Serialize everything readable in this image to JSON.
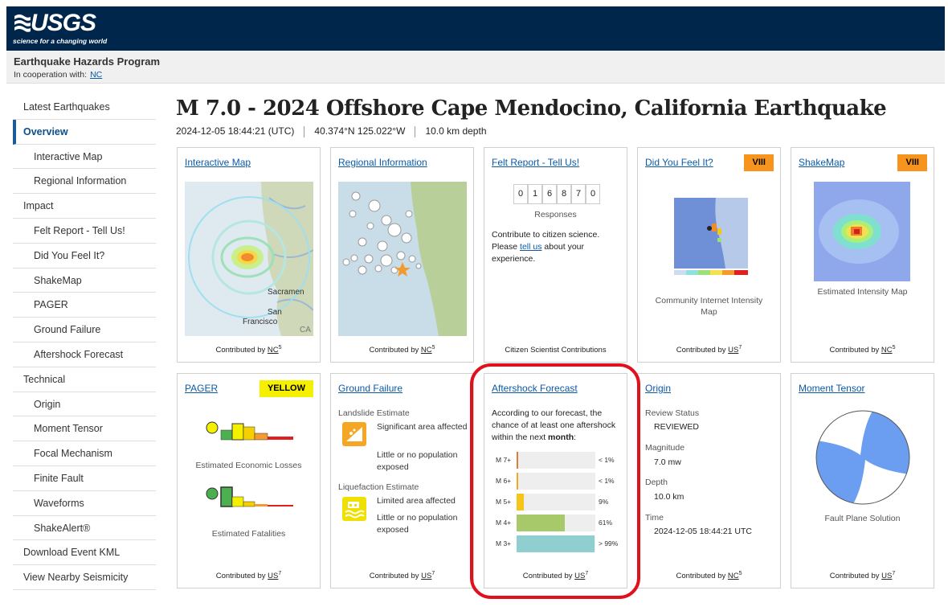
{
  "header": {
    "logo_text": "USGS",
    "logo_tagline": "science for a changing world",
    "program": "Earthquake Hazards Program",
    "cooperation_label": "In cooperation with:",
    "cooperation_link": "NC",
    "brand_color": "#00264c"
  },
  "sidebar": {
    "items": [
      {
        "label": "Latest Earthquakes"
      },
      {
        "label": "Overview"
      },
      {
        "label": "Interactive Map"
      },
      {
        "label": "Regional Information"
      },
      {
        "label": "Impact"
      },
      {
        "label": "Felt Report - Tell Us!"
      },
      {
        "label": "Did You Feel It?"
      },
      {
        "label": "ShakeMap"
      },
      {
        "label": "PAGER"
      },
      {
        "label": "Ground Failure"
      },
      {
        "label": "Aftershock Forecast"
      },
      {
        "label": "Technical"
      },
      {
        "label": "Origin"
      },
      {
        "label": "Moment Tensor"
      },
      {
        "label": "Focal Mechanism"
      },
      {
        "label": "Finite Fault"
      },
      {
        "label": "Waveforms"
      },
      {
        "label": "ShakeAlert®"
      },
      {
        "label": "Download Event KML"
      },
      {
        "label": "View Nearby Seismicity"
      }
    ]
  },
  "event": {
    "title": "M 7.0 - 2024 Offshore Cape Mendocino, California Earthquake",
    "time": "2024-12-05 18:44:21 (UTC)",
    "location": "40.374°N 125.022°W",
    "depth": "10.0 km depth"
  },
  "cards": {
    "interactive_map": {
      "title": "Interactive Map",
      "contrib_prefix": "Contributed by",
      "contrib_net": "NC",
      "contrib_sup": "5",
      "map_labels": [
        "Sacramen",
        "San",
        "Francisco",
        "CA"
      ]
    },
    "regional": {
      "title": "Regional Information",
      "contrib_prefix": "Contributed by",
      "contrib_net": "NC",
      "contrib_sup": "5"
    },
    "felt_report": {
      "title": "Felt Report - Tell Us!",
      "digits": [
        "0",
        "1",
        "6",
        "8",
        "7",
        "0"
      ],
      "responses_label": "Responses",
      "text_before": "Contribute to citizen science. Please",
      "link": "tell us",
      "text_after": "about your experience.",
      "footer": "Citizen Scientist Contributions"
    },
    "dyfi": {
      "title": "Did You Feel It?",
      "badge": "VIII",
      "badge_color": "#f7941d",
      "caption": "Community Internet Intensity Map",
      "contrib_prefix": "Contributed by",
      "contrib_net": "US",
      "contrib_sup": "7"
    },
    "shakemap": {
      "title": "ShakeMap",
      "badge": "VIII",
      "badge_color": "#f7941d",
      "caption": "Estimated Intensity Map",
      "contrib_prefix": "Contributed by",
      "contrib_net": "NC",
      "contrib_sup": "5"
    },
    "pager": {
      "title": "PAGER",
      "badge": "YELLOW",
      "badge_color": "#f5f000",
      "caption_losses": "Estimated Economic Losses",
      "caption_fatalities": "Estimated Fatalities",
      "contrib_prefix": "Contributed by",
      "contrib_net": "US",
      "contrib_sup": "7"
    },
    "ground_failure": {
      "title": "Ground Failure",
      "landslide_label": "Landslide Estimate",
      "landslide_area": "Significant area affected",
      "landslide_pop": "Little or no population exposed",
      "liquefaction_label": "Liquefaction Estimate",
      "liquefaction_area": "Limited area affected",
      "liquefaction_pop": "Little or no population exposed",
      "contrib_prefix": "Contributed by",
      "contrib_net": "US",
      "contrib_sup": "7"
    },
    "aftershock": {
      "title": "Aftershock Forecast",
      "text_before": "According to our forecast, the chance of at least one aftershock within the next",
      "text_bold": "month",
      "text_after": ":",
      "rows": [
        {
          "label": "M 7+",
          "value": "< 1%",
          "fraction": 0.01,
          "color": "#e07b39"
        },
        {
          "label": "M 6+",
          "value": "< 1%",
          "fraction": 0.01,
          "color": "#f5a623"
        },
        {
          "label": "M 5+",
          "value": "9%",
          "fraction": 0.09,
          "color": "#f5c518"
        },
        {
          "label": "M 4+",
          "value": "61%",
          "fraction": 0.61,
          "color": "#a8c96a"
        },
        {
          "label": "M 3+",
          "value": "> 99%",
          "fraction": 0.99,
          "color": "#8fcfcf"
        }
      ],
      "contrib_prefix": "Contributed by",
      "contrib_net": "US",
      "contrib_sup": "7"
    },
    "origin": {
      "title": "Origin",
      "review_label": "Review Status",
      "review_value": "REVIEWED",
      "magnitude_label": "Magnitude",
      "magnitude_value": "7.0 mw",
      "depth_label": "Depth",
      "depth_value": "10.0 km",
      "time_label": "Time",
      "time_value": "2024-12-05 18:44:21 UTC",
      "contrib_prefix": "Contributed by",
      "contrib_net": "NC",
      "contrib_sup": "5"
    },
    "moment_tensor": {
      "title": "Moment Tensor",
      "caption": "Fault Plane Solution",
      "contrib_prefix": "Contributed by",
      "contrib_net": "US",
      "contrib_sup": "7"
    }
  },
  "highlight_color": "#e0101d"
}
